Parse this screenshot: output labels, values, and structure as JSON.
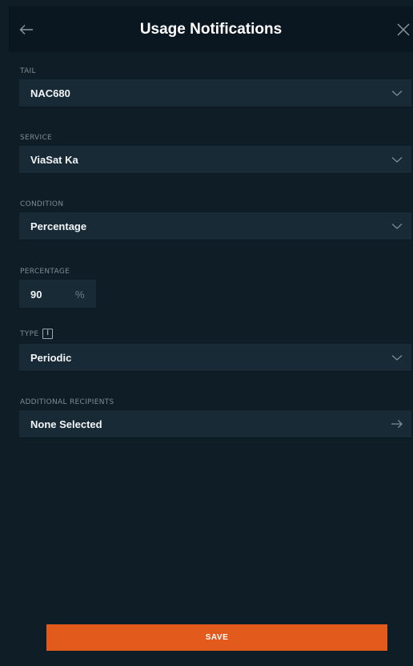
{
  "header": {
    "title": "Usage Notifications",
    "back_icon": "arrow-left-icon",
    "close_icon": "close-icon"
  },
  "fields": {
    "tail": {
      "label": "TAIL",
      "value": "NAC680"
    },
    "service": {
      "label": "SERVICE",
      "value": "ViaSat Ka"
    },
    "condition": {
      "label": "CONDITION",
      "value": "Percentage"
    },
    "percentage": {
      "label": "PERCENTAGE",
      "value": "90",
      "unit": "%"
    },
    "type": {
      "label": "TYPE",
      "info_glyph": "i",
      "value": "Periodic"
    },
    "recipients": {
      "label": "ADDITIONAL RECIPIENTS",
      "value": "None Selected"
    }
  },
  "actions": {
    "save_label": "SAVE"
  },
  "colors": {
    "background": "#0f1d26",
    "header": "#0b1720",
    "field": "#182a35",
    "accent": "#e35a1d",
    "label": "#7c8c96"
  }
}
